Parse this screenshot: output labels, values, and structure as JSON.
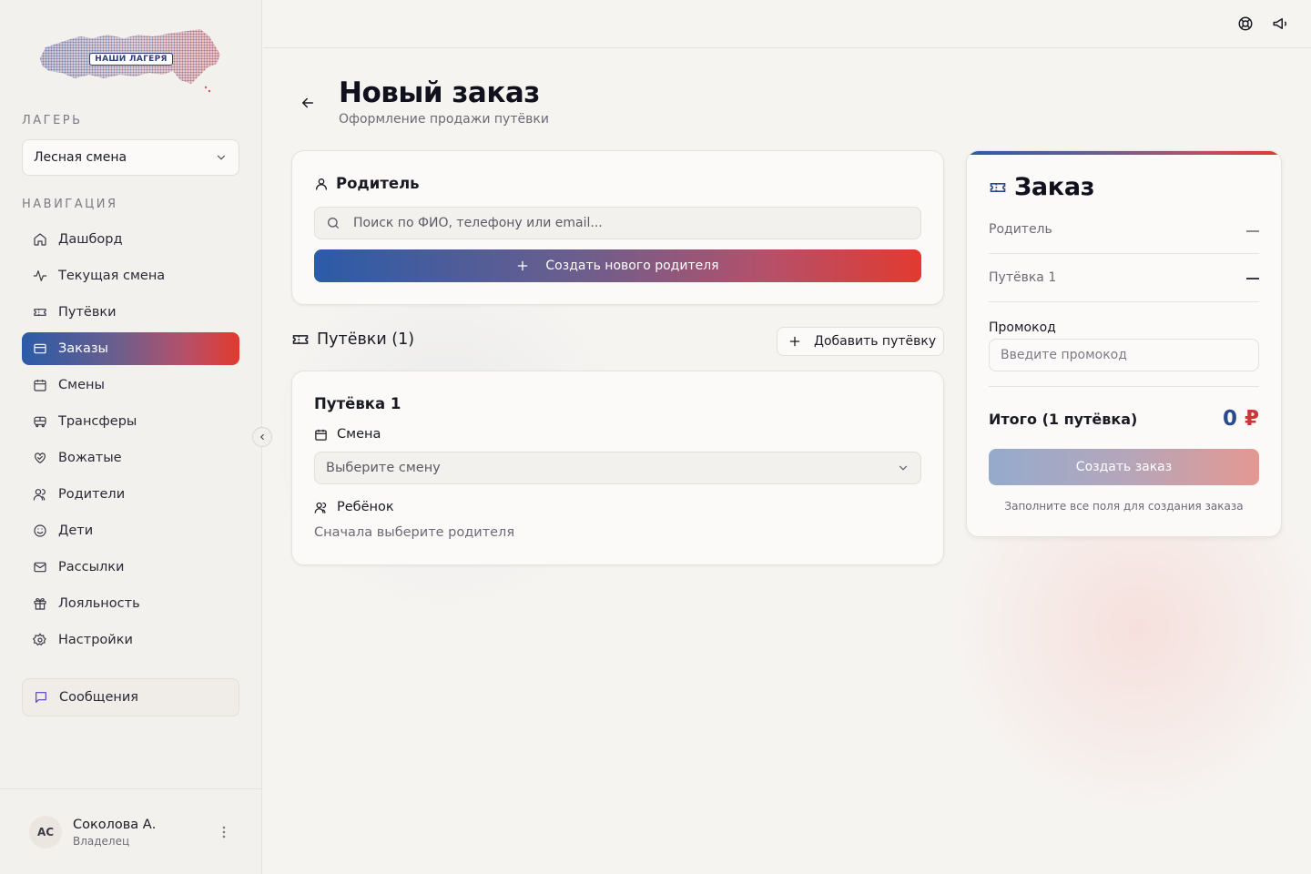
{
  "sidebar": {
    "logo_text": "НАШИ ЛАГЕРЯ",
    "camp_label": "ЛАГЕРЬ",
    "camp_value": "Лесная смена",
    "nav_label": "НАВИГАЦИЯ",
    "items": [
      {
        "label": "Дашборд",
        "icon": "home-icon"
      },
      {
        "label": "Текущая смена",
        "icon": "activity-icon"
      },
      {
        "label": "Путёвки",
        "icon": "ticket-icon"
      },
      {
        "label": "Заказы",
        "icon": "credit-card-icon",
        "active": true
      },
      {
        "label": "Смены",
        "icon": "calendar-icon"
      },
      {
        "label": "Трансферы",
        "icon": "bus-icon"
      },
      {
        "label": "Вожатые",
        "icon": "heart-handshake-icon"
      },
      {
        "label": "Родители",
        "icon": "users-icon"
      },
      {
        "label": "Дети",
        "icon": "smile-icon"
      },
      {
        "label": "Рассылки",
        "icon": "mail-icon"
      },
      {
        "label": "Лояльность",
        "icon": "gift-icon"
      },
      {
        "label": "Настройки",
        "icon": "gear-icon"
      }
    ],
    "messages_label": "Сообщения",
    "user": {
      "initials": "АС",
      "name": "Соколова А.",
      "role": "Владелец"
    }
  },
  "header": {
    "title": "Новый заказ",
    "subtitle": "Оформление продажи путёвки"
  },
  "parent_card": {
    "title": "Родитель",
    "search_placeholder": "Поиск по ФИО, телефону или email...",
    "create_button": "Создать нового родителя"
  },
  "vouchers": {
    "heading": "Путёвки (1)",
    "add_button": "Добавить путёвку",
    "items": [
      {
        "title": "Путёвка 1",
        "shift_label": "Смена",
        "shift_placeholder": "Выберите смену",
        "child_label": "Ребёнок",
        "child_hint": "Сначала выберите родителя"
      }
    ]
  },
  "order": {
    "title": "Заказ",
    "parent_label": "Родитель",
    "voucher_label": "Путёвка 1",
    "promo_label": "Промокод",
    "promo_placeholder": "Введите промокод",
    "total_label": "Итого (1 путёвка)",
    "total_value": "0",
    "currency": "₽",
    "create_button": "Создать заказ",
    "hint": "Заполните все поля для создания заказа"
  },
  "colors": {
    "accent_blue": "#2b5ba8",
    "accent_red": "#e23a2f",
    "background": "#f6f4f1"
  }
}
